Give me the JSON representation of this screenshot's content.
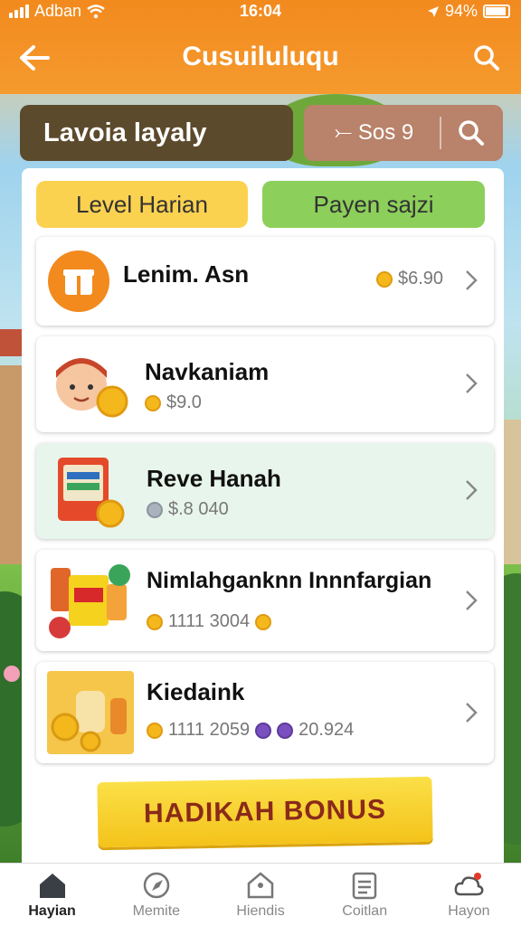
{
  "status_bar": {
    "carrier": "Adban",
    "time": "16:04",
    "battery": "94%"
  },
  "header": {
    "title": "Cusuiluluqu"
  },
  "search": {
    "value": "Lavoia layaly"
  },
  "filter": {
    "text": "⤚ Sos 9"
  },
  "tabs": [
    {
      "label": "Level Harian",
      "color": "#fbd250"
    },
    {
      "label": "Payen sajzi",
      "color": "#8ccf5a"
    }
  ],
  "items": [
    {
      "name": "Lenim. Asn",
      "price": "$6.90",
      "icon": "gift-box-icon"
    },
    {
      "name": "Navkaniam",
      "price": "$9.0",
      "icon": "avatar-with-coin"
    },
    {
      "name": "Reve Hanah",
      "price": "$.8 040",
      "icon": "product-box-with-coin"
    },
    {
      "name": "Nimlahganknn Innnfargian",
      "price": "1111 3004",
      "icon": "grocery-bundle"
    },
    {
      "name": "Kiedaink",
      "price": "1111 2059",
      "extra": "20.924",
      "icon": "jars-and-coins"
    }
  ],
  "bonus": {
    "label": "HADIKAH BONUS"
  },
  "nav": [
    {
      "label": "Hayian",
      "icon": "home-icon",
      "active": true
    },
    {
      "label": "Memite",
      "icon": "compass-icon",
      "active": false
    },
    {
      "label": "Hiendis",
      "icon": "tag-icon",
      "active": false
    },
    {
      "label": "Coitlan",
      "icon": "clipboard-icon",
      "active": false
    },
    {
      "label": "Hayon",
      "icon": "cloud-alert-icon",
      "active": false
    }
  ],
  "colors": {
    "header": "#f28a1e",
    "search_bg": "#5c4a2c",
    "filter_bg": "#b9826a",
    "bonus": "#f4c31a",
    "highlight_card": "#e8f5ec"
  }
}
